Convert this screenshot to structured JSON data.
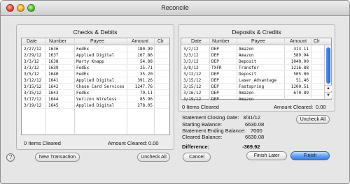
{
  "window": {
    "title": "Reconcile"
  },
  "checks": {
    "title": "Checks & Debits",
    "columns": {
      "date": "Date",
      "number": "Number",
      "payee": "Payee",
      "amount": "Amount",
      "clr": "Clr"
    },
    "rows": [
      {
        "date": "2/27/12",
        "number": "1636",
        "payee": "FedEx",
        "amount": "180.99"
      },
      {
        "date": "2/29/12",
        "number": "1637",
        "payee": "Applied Digital",
        "amount": "167.86"
      },
      {
        "date": "3/3/12",
        "number": "1638",
        "payee": "Marty Knapp",
        "amount": "54.08"
      },
      {
        "date": "3/3/12",
        "number": "1639",
        "payee": "FedEx",
        "amount": "25.71"
      },
      {
        "date": "3/5/12",
        "number": "1640",
        "payee": "FedEx",
        "amount": "35.20"
      },
      {
        "date": "3/12/12",
        "number": "1641",
        "payee": "Applied Digital",
        "amount": "391.26"
      },
      {
        "date": "3/15/12",
        "number": "1642",
        "payee": "Chase Card Services",
        "amount": "1247.76"
      },
      {
        "date": "3/15/12",
        "number": "1643",
        "payee": "FedEx",
        "amount": "79.11"
      },
      {
        "date": "3/17/12",
        "number": "1644",
        "payee": "Verizon Wireless",
        "amount": "85.96"
      },
      {
        "date": "3/19/12",
        "number": "1645",
        "payee": "Applied Digital",
        "amount": "278.05"
      }
    ],
    "items_cleared": "0 Items Cleared",
    "amount_cleared_label": "Amount Cleared:",
    "amount_cleared": "0.00"
  },
  "deposits": {
    "title": "Deposits & Credits",
    "columns": {
      "date": "Date",
      "number": "Number",
      "payee": "Payee",
      "amount": "Amount",
      "clr": "Clr"
    },
    "rows": [
      {
        "date": "3/2/12",
        "number": "DEP",
        "payee": "Amazon",
        "amount": "313.11"
      },
      {
        "date": "3/3/12",
        "number": "DEP",
        "payee": "Amazon",
        "amount": "589.94"
      },
      {
        "date": "3/3/12",
        "number": "DEP",
        "payee": "Deposit",
        "amount": "1040.00"
      },
      {
        "date": "3/8/12",
        "number": "TXFR",
        "payee": "Transfer",
        "amount": "1216.88"
      },
      {
        "date": "3/12/12",
        "number": "DEP",
        "payee": "Deposit",
        "amount": "505.00"
      },
      {
        "date": "3/15/12",
        "number": "DEP",
        "payee": "Laser Advantage",
        "amount": "51.46"
      },
      {
        "date": "3/15/12",
        "number": "DEP",
        "payee": "Fastspring",
        "amount": "1200.51"
      },
      {
        "date": "3/16/12",
        "number": "DEP",
        "payee": "Amazon",
        "amount": "670.89"
      },
      {
        "date": "3/19/12",
        "number": "DEP",
        "payee": "Amazon",
        "amount": ""
      }
    ],
    "items_cleared": "0 Items Cleared",
    "amount_cleared_label": "Amount Cleared:",
    "amount_cleared": "0.00"
  },
  "summary": {
    "closing_date_label": "Statement Closing Date:",
    "closing_date": "3/31/12",
    "starting_balance_label": "Starting Balance:",
    "starting_balance": "6630.08",
    "ending_balance_label": "Statement Ending Balance:",
    "ending_balance": "7000",
    "cleared_balance_label": "Cleared Balance:",
    "cleared_balance": "6630.08",
    "difference_label": "Difference:",
    "difference": "-369.92"
  },
  "buttons": {
    "new_transaction": "New Transaction",
    "uncheck_all": "Uncheck All",
    "uncheck_all_deposits": "Uncheck All",
    "cancel": "Cancel",
    "finish_later": "Finish Later",
    "finish": "Finish"
  },
  "icons": {
    "help": "?",
    "scroll_up": "▲",
    "scroll_down": "▼"
  },
  "colors": {
    "accent": "#3a82e6"
  }
}
